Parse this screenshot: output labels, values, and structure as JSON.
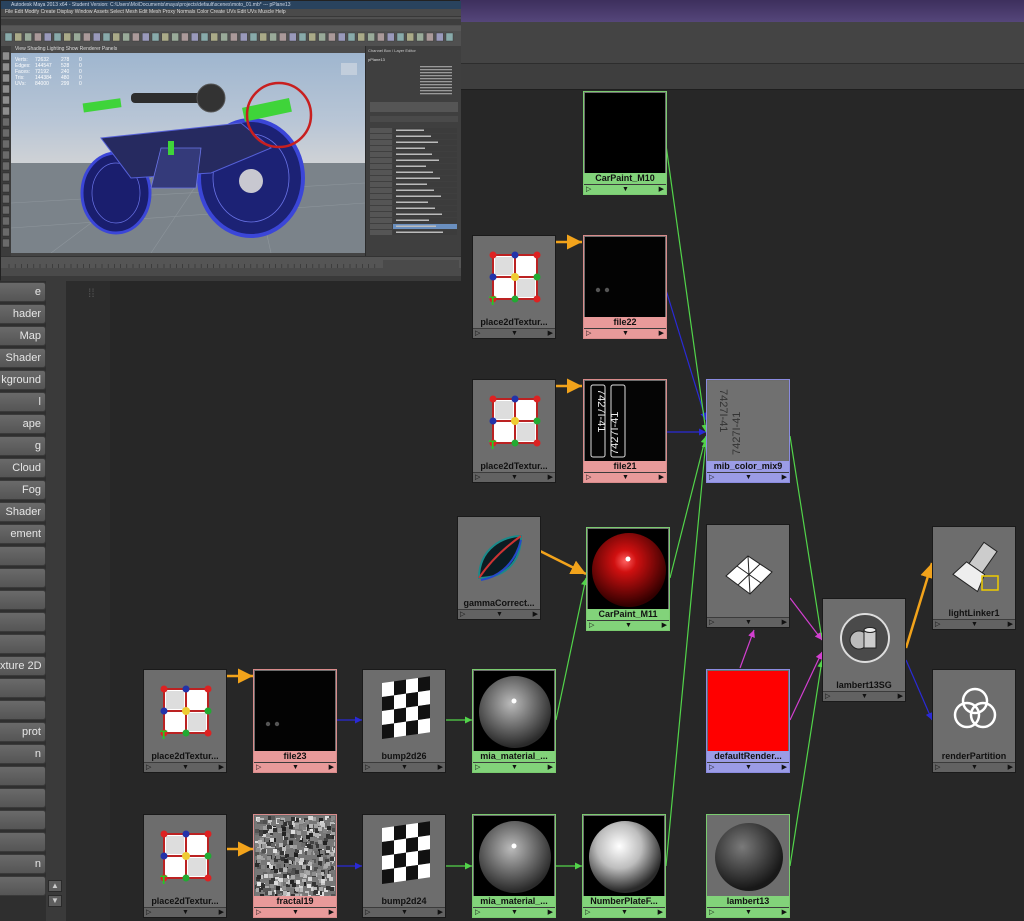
{
  "maya": {
    "title": "Autodesk Maya 2013 x64 - Student Version: C:\\Users\\Mo\\Documents\\maya\\projects\\default\\scenes\\moto_01.mb* --- pPlane13",
    "menu": "File  Edit  Modify  Create  Display  Window  Assets  Select  Mesh  Edit Mesh  Proxy  Normals  Color  Create UVs  Edit UVs  Muscle  Help",
    "viewport_menu": "View  Shading  Lighting  Show  Renderer  Panels",
    "channel_box_title": "Channel Box / Layer Editor",
    "object_name": "pPlane13",
    "stats": [
      {
        "label": "Verts:",
        "a": "72632",
        "b": "278",
        "c": "0"
      },
      {
        "label": "Edges:",
        "a": "144547",
        "b": "528",
        "c": "0"
      },
      {
        "label": "Faces:",
        "a": "72192",
        "b": "240",
        "c": "0"
      },
      {
        "label": "Tris:",
        "a": "144384",
        "b": "480",
        "c": "0"
      },
      {
        "label": "UVs:",
        "a": "84000",
        "b": "299",
        "c": "0"
      }
    ]
  },
  "left_list": {
    "items": [
      "e",
      "hader",
      "Map",
      "Shader",
      "kground",
      "l",
      "ape",
      "g",
      "Cloud",
      "Fog",
      "Shader",
      "ement",
      "",
      "",
      "",
      "",
      "",
      "xture 2D",
      "",
      "",
      "prot",
      "n",
      "",
      "",
      "",
      "",
      "n",
      ""
    ]
  },
  "nodes": [
    {
      "id": "carpaint_m10",
      "label": "CarPaint_M10",
      "color": "green",
      "swatch": "black"
    },
    {
      "id": "place2d_a",
      "label": "place2dTextur...",
      "color": "gray",
      "swatch": "place2d"
    },
    {
      "id": "file22",
      "label": "file22",
      "color": "pink",
      "swatch": "file-dots"
    },
    {
      "id": "place2d_b",
      "label": "place2dTextur...",
      "color": "gray",
      "swatch": "place2d"
    },
    {
      "id": "file21",
      "label": "file21",
      "color": "pink",
      "swatch": "plate"
    },
    {
      "id": "mib_color_mix9",
      "label": "mib_color_mix9",
      "color": "blue",
      "swatch": "plate-gray"
    },
    {
      "id": "gamma",
      "label": "gammaCorrect...",
      "color": "gray",
      "swatch": "gamma"
    },
    {
      "id": "carpaint_m11",
      "label": "CarPaint_M11",
      "color": "green",
      "swatch": "red-sphere"
    },
    {
      "id": "hidden_node",
      "label": "",
      "color": "gray",
      "swatch": "mesh"
    },
    {
      "id": "lambert13sg",
      "label": "lambert13SG",
      "color": "gray",
      "swatch": "sg"
    },
    {
      "id": "lightlinker1",
      "label": "lightLinker1",
      "color": "gray",
      "swatch": "light"
    },
    {
      "id": "renderpartition",
      "label": "renderPartition",
      "color": "gray",
      "swatch": "partition"
    },
    {
      "id": "place2d_c",
      "label": "place2dTextur...",
      "color": "gray",
      "swatch": "place2d"
    },
    {
      "id": "file23",
      "label": "file23",
      "color": "pink",
      "swatch": "file-dots"
    },
    {
      "id": "bump2d26",
      "label": "bump2d26",
      "color": "gray",
      "swatch": "checker"
    },
    {
      "id": "mia_a",
      "label": "mia_material_...",
      "color": "green",
      "swatch": "gray-sphere"
    },
    {
      "id": "default_render",
      "label": "defaultRender...",
      "color": "blue",
      "swatch": "red"
    },
    {
      "id": "place2d_d",
      "label": "place2dTextur...",
      "color": "gray",
      "swatch": "place2d"
    },
    {
      "id": "fractal19",
      "label": "fractal19",
      "color": "pink",
      "swatch": "noise"
    },
    {
      "id": "bump2d24",
      "label": "bump2d24",
      "color": "gray",
      "swatch": "checker"
    },
    {
      "id": "mia_b",
      "label": "mia_material_...",
      "color": "green",
      "swatch": "gray-sphere"
    },
    {
      "id": "numberplate",
      "label": "NumberPlateF...",
      "color": "green",
      "swatch": "white-sphere"
    },
    {
      "id": "lambert13",
      "label": "lambert13",
      "color": "green",
      "swatch": "dark-sphere"
    }
  ],
  "plate_text": "7427I-41",
  "colors": {
    "wire_green": "#52d44a",
    "wire_blue": "#2a2ad6",
    "wire_orange": "#f2a31b",
    "wire_magenta": "#d23fd0",
    "label_green": "#82d37a",
    "label_pink": "#e89a9a",
    "label_blue": "#9b9ce6"
  }
}
